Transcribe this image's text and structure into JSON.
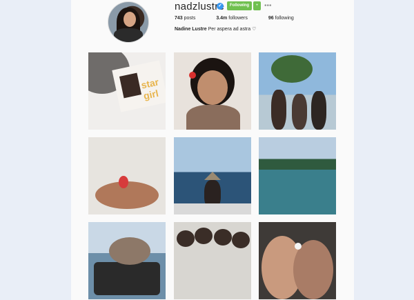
{
  "profile": {
    "username": "nadzlustre",
    "follow_button": "Following",
    "dropdown_icon": "+",
    "more_icon": "•••",
    "posts_count": "743",
    "posts_label": "posts",
    "followers_count": "3.4m",
    "followers_label": "followers",
    "following_count": "96",
    "following_label": "following",
    "full_name": "Nadine Lustre",
    "bio": "Per aspera ad astra ♡"
  },
  "posts": [
    {
      "id": "post-1",
      "text": "star girl"
    },
    {
      "id": "post-2"
    },
    {
      "id": "post-3"
    },
    {
      "id": "post-4"
    },
    {
      "id": "post-5"
    },
    {
      "id": "post-6"
    },
    {
      "id": "post-7"
    },
    {
      "id": "post-8"
    },
    {
      "id": "post-9"
    }
  ],
  "colors": {
    "accent": "#70c050",
    "verified": "#3897f0",
    "background": "#e9eef7"
  }
}
